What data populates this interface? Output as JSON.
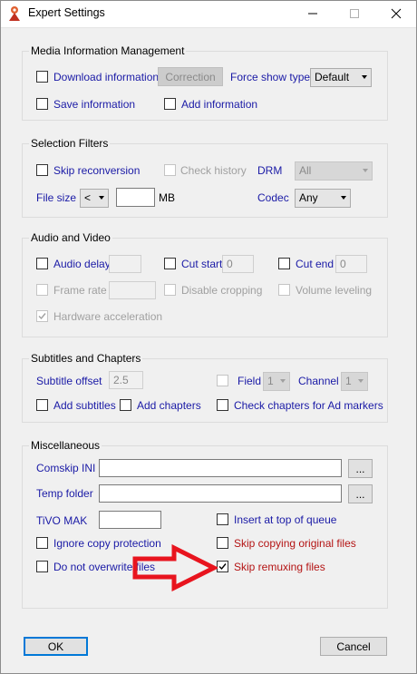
{
  "window": {
    "title": "Expert Settings",
    "app_icon": "app-icon",
    "controls": [
      "minimize-icon",
      "maximize-icon",
      "close-icon"
    ]
  },
  "media": {
    "title": "Media Information Management",
    "download_info": "Download information",
    "correction": "Correction",
    "force_show_type": "Force show type",
    "force_show_type_value": "Default",
    "save_info": "Save information",
    "add_info": "Add information"
  },
  "filters": {
    "title": "Selection Filters",
    "skip_reconversion": "Skip reconversion",
    "check_history": "Check history",
    "drm": "DRM",
    "drm_value": "All",
    "file_size": "File size",
    "file_size_op": "<",
    "file_size_value": "",
    "mb": "MB",
    "codec": "Codec",
    "codec_value": "Any"
  },
  "av": {
    "title": "Audio and Video",
    "audio_delay": "Audio delay",
    "audio_delay_value": "",
    "cut_start": "Cut start",
    "cut_start_value": "0",
    "cut_end": "Cut end",
    "cut_end_value": "0",
    "frame_rate": "Frame rate",
    "frame_rate_value": "",
    "disable_cropping": "Disable cropping",
    "volume_leveling": "Volume leveling",
    "hw_accel": "Hardware acceleration"
  },
  "subs": {
    "title": "Subtitles and Chapters",
    "subtitle_offset": "Subtitle offset",
    "subtitle_offset_value": "2.5",
    "field": "Field",
    "field_value": "1",
    "channel": "Channel",
    "channel_value": "1",
    "add_subtitles": "Add subtitles",
    "add_chapters": "Add chapters",
    "check_chapters": "Check chapters for Ad markers"
  },
  "misc": {
    "title": "Miscellaneous",
    "comskip_ini": "Comskip INI",
    "comskip_ini_value": "",
    "temp_folder": "Temp folder",
    "temp_folder_value": "",
    "browse": "...",
    "tivo_mak": "TiVO MAK",
    "tivo_mak_value": "",
    "insert_top": "Insert at top of queue",
    "ignore_copy": "Ignore copy protection",
    "skip_copying": "Skip copying original files",
    "no_overwrite": "Do not overwrite files",
    "skip_remuxing": "Skip remuxing files"
  },
  "buttons": {
    "ok": "OK",
    "cancel": "Cancel"
  },
  "colors": {
    "label_blue": "#1a1aa6",
    "label_red": "#b41414",
    "arrow_red": "#e8141e",
    "ok_focus": "#0078d7"
  }
}
